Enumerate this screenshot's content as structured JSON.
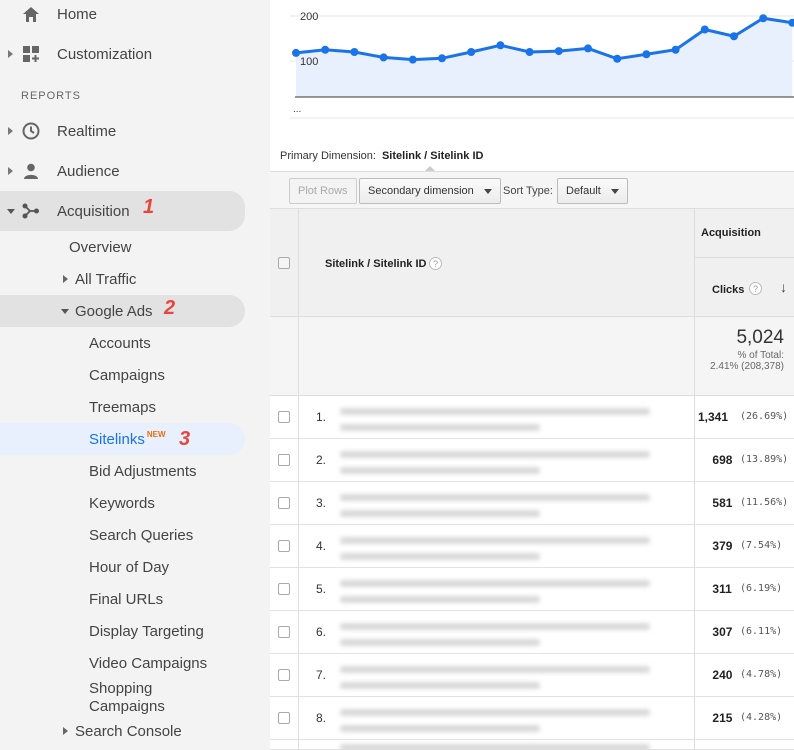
{
  "sidebar": {
    "home": "Home",
    "customization": "Customization",
    "reports_label": "REPORTS",
    "realtime": "Realtime",
    "audience": "Audience",
    "acquisition": "Acquisition",
    "overview": "Overview",
    "all_traffic": "All Traffic",
    "google_ads": "Google Ads",
    "ads_items": [
      "Accounts",
      "Campaigns",
      "Treemaps",
      "Sitelinks",
      "Bid Adjustments",
      "Keywords",
      "Search Queries",
      "Hour of Day",
      "Final URLs",
      "Display Targeting",
      "Video Campaigns",
      "Shopping Campaigns"
    ],
    "new_badge": "NEW",
    "search_console": "Search Console",
    "step_badges": [
      "1",
      "2",
      "3"
    ]
  },
  "chart_data": {
    "type": "line",
    "y_ticks": [
      "200",
      "100",
      "..."
    ],
    "ylim": [
      0,
      250
    ],
    "values": [
      118,
      125,
      120,
      108,
      103,
      106,
      120,
      135,
      120,
      122,
      128,
      105,
      115,
      125,
      170,
      155,
      195,
      185
    ],
    "line_color": "#1a73e8",
    "fill_color": "#e8f0fe"
  },
  "main": {
    "primary_dimension_label": "Primary Dimension:",
    "primary_dimension_value": "Sitelink / Sitelink ID",
    "plot_rows": "Plot Rows",
    "secondary_dimension": "Secondary dimension",
    "sort_type_label": "Sort Type:",
    "sort_type_value": "Default"
  },
  "table": {
    "col_dimension": "Sitelink / Sitelink ID",
    "group_acquisition": "Acquisition",
    "col_clicks": "Clicks",
    "help": "?",
    "sort_arrow": "↓",
    "total": "5,024",
    "total_pct_label": "% of Total:",
    "total_pct_value": "2.41% (208,378)",
    "rows": [
      {
        "idx": "1.",
        "value": "1,341",
        "pct": "(26.69%)"
      },
      {
        "idx": "2.",
        "value": "698",
        "pct": "(13.89%)"
      },
      {
        "idx": "3.",
        "value": "581",
        "pct": "(11.56%)"
      },
      {
        "idx": "4.",
        "value": "379",
        "pct": "(7.54%)"
      },
      {
        "idx": "5.",
        "value": "311",
        "pct": "(6.19%)"
      },
      {
        "idx": "6.",
        "value": "307",
        "pct": "(6.11%)"
      },
      {
        "idx": "7.",
        "value": "240",
        "pct": "(4.78%)"
      },
      {
        "idx": "8.",
        "value": "215",
        "pct": "(4.28%)"
      }
    ]
  }
}
